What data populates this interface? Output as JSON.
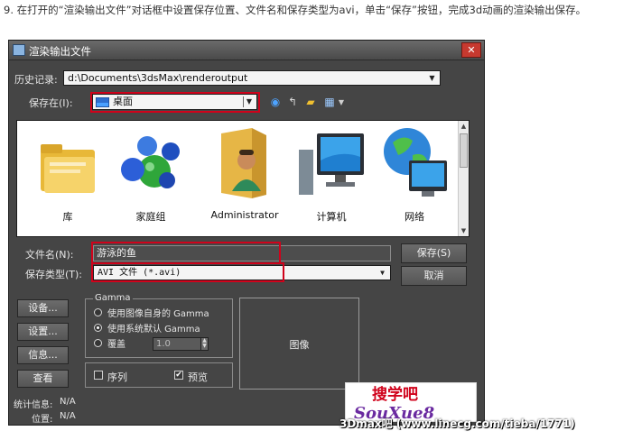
{
  "instruction": "9. 在打开的“渲染输出文件”对话框中设置保存位置、文件名和保存类型为avi，单击“保存”按钮，完成3d动画的渲染输出保存。",
  "dialog": {
    "title": "渲染输出文件",
    "close_label": "✕",
    "history_label": "历史记录:",
    "history_value": "d:\\Documents\\3dsMax\\renderoutput",
    "save_in_label": "保存在(I):",
    "save_in_value": "桌面",
    "files": [
      {
        "name": "库",
        "icon": "library-folder-icon"
      },
      {
        "name": "家庭组",
        "icon": "homegroup-icon"
      },
      {
        "name": "Administrator",
        "icon": "user-folder-icon"
      },
      {
        "name": "计算机",
        "icon": "computer-icon"
      },
      {
        "name": "网络",
        "icon": "network-globe-icon"
      }
    ],
    "filename_label": "文件名(N):",
    "filename_value": "游泳的鱼",
    "filetype_label": "保存类型(T):",
    "filetype_value": "AVI 文件 (*.avi)",
    "save_button": "保存(S)",
    "cancel_button": "取消",
    "setup_button": "设备...",
    "settings_button": "设置...",
    "info_button": "信息...",
    "view_button": "查看",
    "gamma": {
      "title": "Gamma",
      "option_own": "使用图像自身的 Gamma",
      "option_system": "使用系统默认 Gamma",
      "option_override": "覆盖",
      "override_value": "1.0"
    },
    "sequence_label": "序列",
    "preview_label": "预览",
    "preview_checked": true,
    "preview_area_label": "图像",
    "stats_label": "统计信息:",
    "stats_value": "N/A",
    "location_label": "位置:",
    "location_value": "N/A"
  },
  "watermark": {
    "logo_top": "搜学吧",
    "logo_bottom": "SouXue8",
    "site_text": "3Dmax吧 (www.linecg.com/tieba/1771)"
  },
  "colors": {
    "highlight_red": "#d0021b",
    "dialog_bg": "#454545",
    "close_red": "#c7392f"
  }
}
